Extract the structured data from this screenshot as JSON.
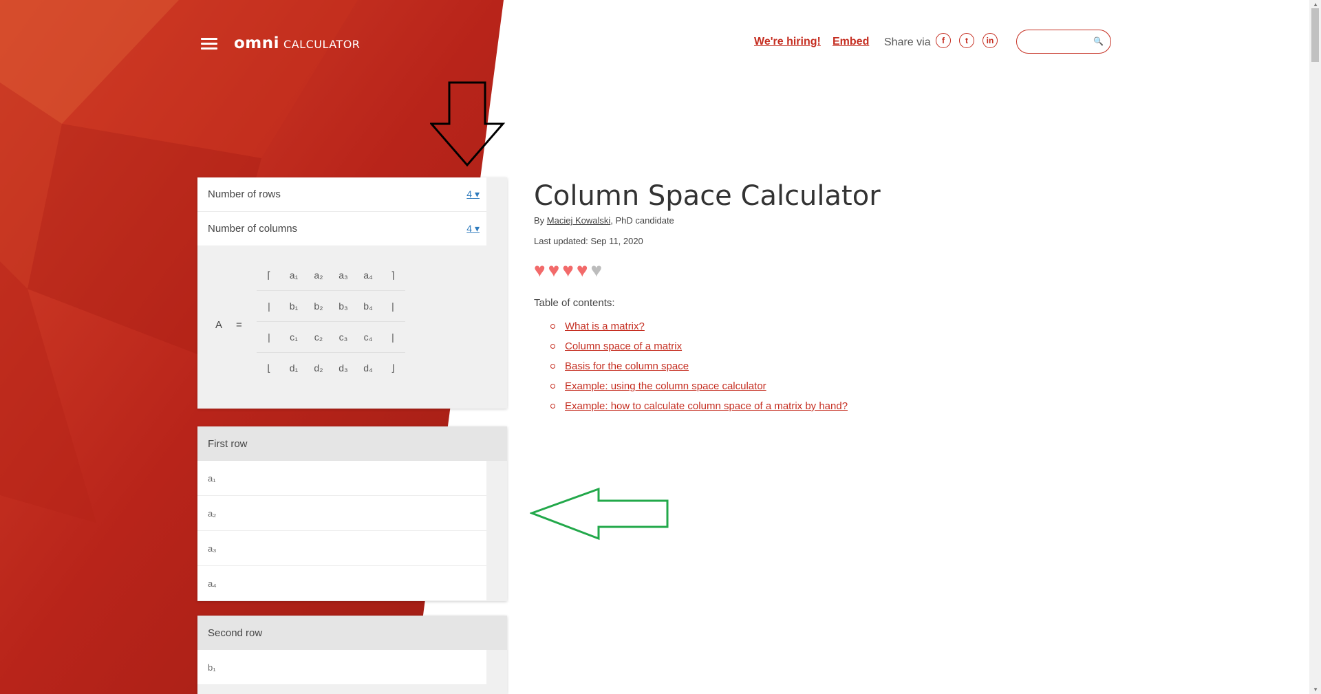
{
  "header": {
    "logo_omni": "omni",
    "logo_calculator": "CALCULATOR",
    "hiring_label": "We're hiring!",
    "embed_label": "Embed",
    "share_label": "Share via",
    "share_icons": [
      "f",
      "t",
      "in"
    ],
    "search_placeholder": ""
  },
  "calculator": {
    "rows_label": "Number of rows",
    "rows_value": "4",
    "columns_label": "Number of columns",
    "columns_value": "4",
    "matrix_name": "A",
    "matrix_eq": "=",
    "matrix": [
      [
        "⌈",
        "a₁",
        "a₂",
        "a₃",
        "a₄",
        "⌉"
      ],
      [
        "|",
        "b₁",
        "b₂",
        "b₃",
        "b₄",
        "|"
      ],
      [
        "|",
        "c₁",
        "c₂",
        "c₃",
        "c₄",
        "|"
      ],
      [
        "⌊",
        "d₁",
        "d₂",
        "d₃",
        "d₄",
        "⌋"
      ]
    ],
    "first_row": {
      "heading": "First row",
      "fields": [
        "a₁",
        "a₂",
        "a₃",
        "a₄"
      ]
    },
    "second_row": {
      "heading": "Second row",
      "fields": [
        "b₁"
      ]
    }
  },
  "article": {
    "title": "Column Space Calculator",
    "by_prefix": "By",
    "author": "Maciej Kowalski",
    "author_suffix": ", PhD candidate",
    "last_updated": "Last updated: Sep 11, 2020",
    "rating": 4,
    "rating_max": 5,
    "toc_label": "Table of contents:",
    "toc": [
      "What is a matrix?",
      "Column space of a matrix",
      "Basis for the column space",
      "Example: using the column space calculator",
      "Example: how to calculate column space of a matrix by hand?"
    ]
  },
  "colors": {
    "brand": "#c52e21",
    "bg_red": "#b8261b",
    "heart_on": "#f26a6a",
    "heart_off": "#bcbcbc",
    "arrow_green": "#22a84a"
  }
}
